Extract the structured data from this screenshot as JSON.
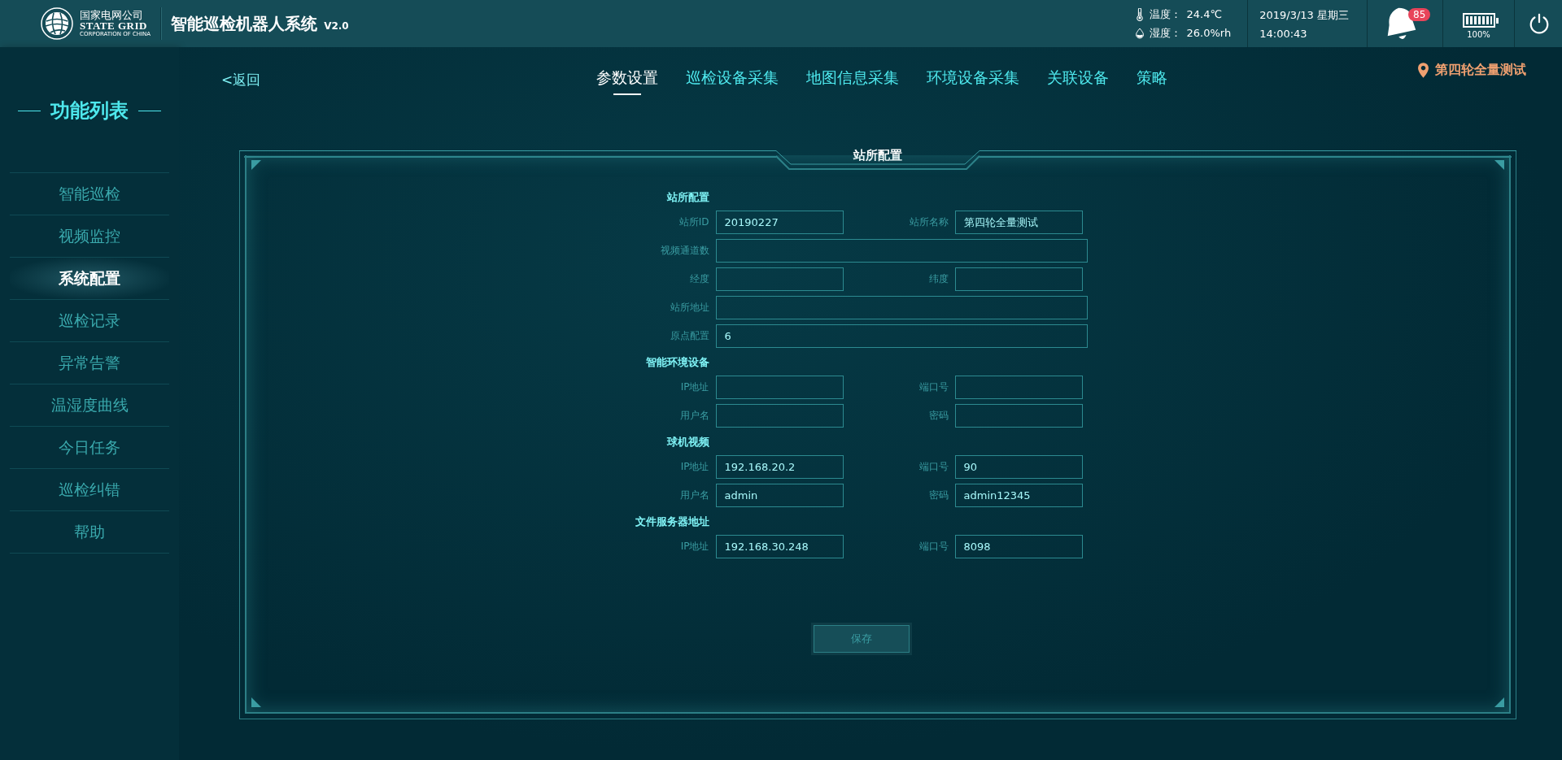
{
  "header": {
    "logo": {
      "name_cn": "国家电网公司",
      "name_en": "STATE GRID",
      "sub": "CORPORATION OF CHINA"
    },
    "title": "智能巡检机器人系统",
    "version": "V2.0",
    "temperature": {
      "label": "温度：",
      "value": "24.4℃"
    },
    "humidity": {
      "label": "湿度：",
      "value": "26.0%rh"
    },
    "date": "2019/3/13 星期三",
    "time": "14:00:43",
    "alerts": "85",
    "battery": {
      "label": "100%",
      "level": 1
    }
  },
  "sidebar": {
    "title": "功能列表",
    "items": [
      {
        "label": "智能巡检",
        "selected": false
      },
      {
        "label": "视频监控",
        "selected": false
      },
      {
        "label": "系统配置",
        "selected": true
      },
      {
        "label": "巡检记录",
        "selected": false
      },
      {
        "label": "异常告警",
        "selected": false
      },
      {
        "label": "温湿度曲线",
        "selected": false
      },
      {
        "label": "今日任务",
        "selected": false
      },
      {
        "label": "巡检纠错",
        "selected": false
      },
      {
        "label": "帮助",
        "selected": false
      }
    ]
  },
  "back": "<返回",
  "tabs": [
    {
      "label": "参数设置",
      "selected": true
    },
    {
      "label": "巡检设备采集",
      "selected": false
    },
    {
      "label": "地图信息采集",
      "selected": false
    },
    {
      "label": "环境设备采集",
      "selected": false
    },
    {
      "label": "关联设备",
      "selected": false
    },
    {
      "label": "策略",
      "selected": false
    }
  ],
  "location": "第四轮全量测试",
  "panel": {
    "title": "站所配置",
    "sections": [
      {
        "title": "站所配置",
        "rows": [
          [
            {
              "label": "站所ID",
              "value": "20190227"
            },
            {
              "label": "站所名称",
              "value": "第四轮全量测试"
            }
          ],
          [
            {
              "label": "视频通道数"
            }
          ],
          [
            {
              "label": "经度"
            },
            {
              "label": "纬度"
            }
          ],
          [
            {
              "label": "站所地址"
            }
          ],
          [
            {
              "label": "原点配置",
              "value": "6"
            }
          ]
        ]
      },
      {
        "title": "智能环境设备",
        "rows": [
          [
            {
              "label": "IP地址"
            },
            {
              "label": "端口号"
            }
          ],
          [
            {
              "label": "用户名"
            },
            {
              "label": "密码"
            }
          ]
        ]
      },
      {
        "title": "球机视频",
        "rows": [
          [
            {
              "label": "IP地址",
              "value": "192.168.20.2"
            },
            {
              "label": "端口号",
              "value": "90"
            }
          ],
          [
            {
              "label": "用户名",
              "value": "admin"
            },
            {
              "label": "密码",
              "value": "admin12345"
            }
          ]
        ]
      },
      {
        "title": "文件服务器地址",
        "rows": [
          [
            {
              "label": "IP地址",
              "value": "192.168.30.248"
            },
            {
              "label": "端口号",
              "value": "8098"
            }
          ]
        ]
      }
    ],
    "save": "保存"
  }
}
